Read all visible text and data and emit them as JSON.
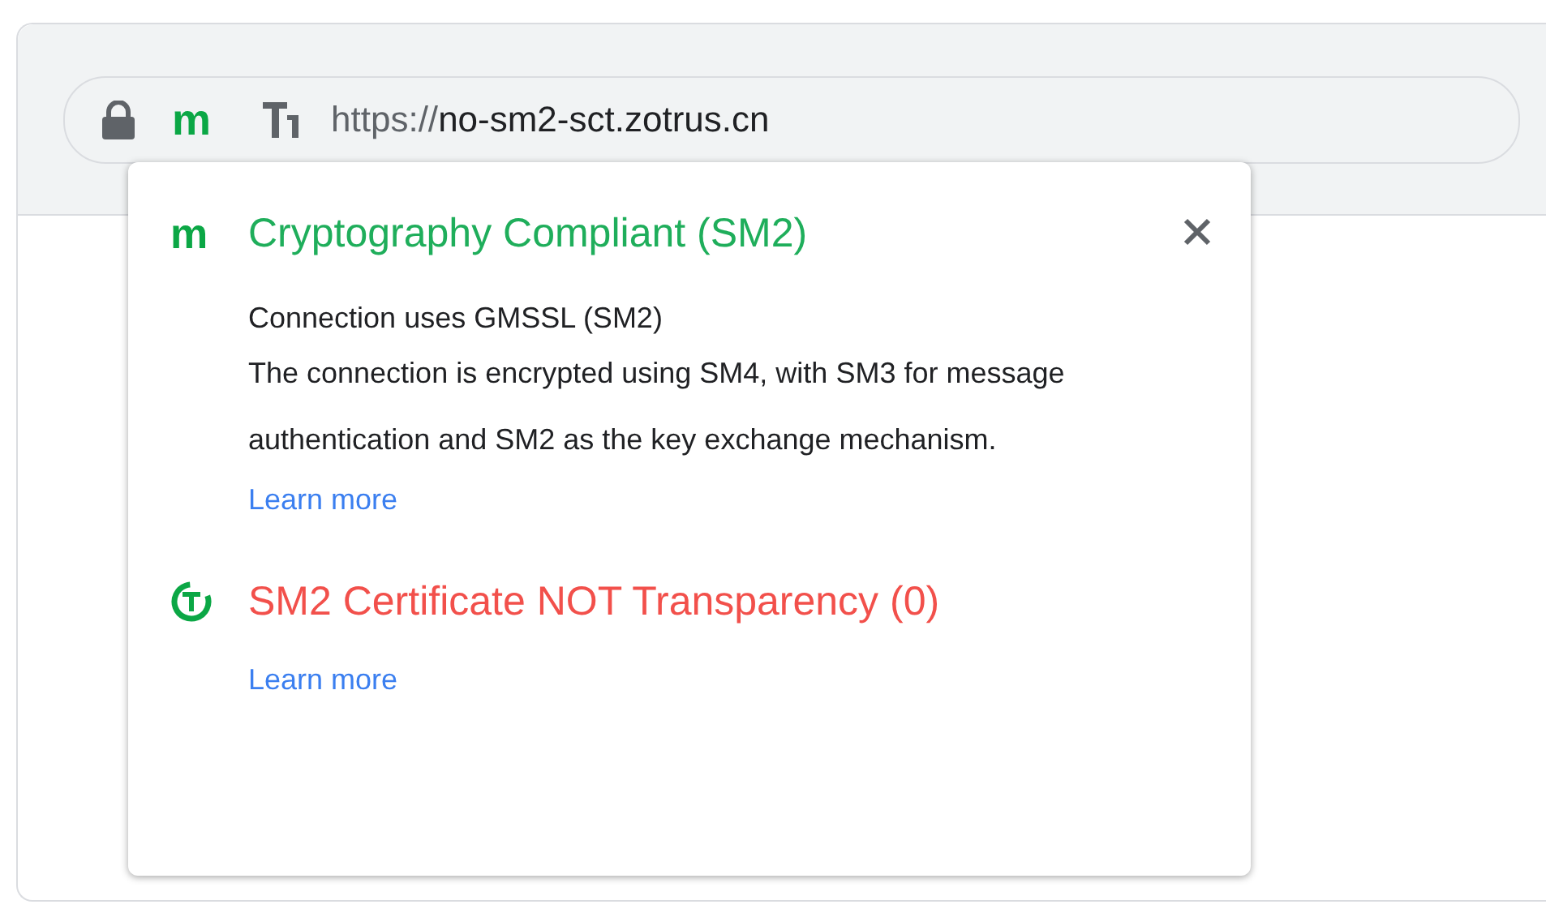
{
  "address_bar": {
    "secure": true,
    "mark": "m",
    "url_scheme": "https://",
    "url_host": "no-sm2-sct.zotrus.cn"
  },
  "popup": {
    "sections": [
      {
        "kind": "compliance",
        "color": "#1fae5b",
        "icon_text": "m",
        "title": "Cryptography Compliant (SM2)",
        "subtitle": "Connection uses GMSSL (SM2)",
        "body": "The connection is encrypted using SM4, with SM3 for message authentication and SM2 as the key exchange mechanism.",
        "link": "Learn more"
      },
      {
        "kind": "transparency",
        "color": "#f2504b",
        "title": "SM2 Certificate NOT Transparency (0)",
        "link": "Learn more"
      }
    ]
  }
}
